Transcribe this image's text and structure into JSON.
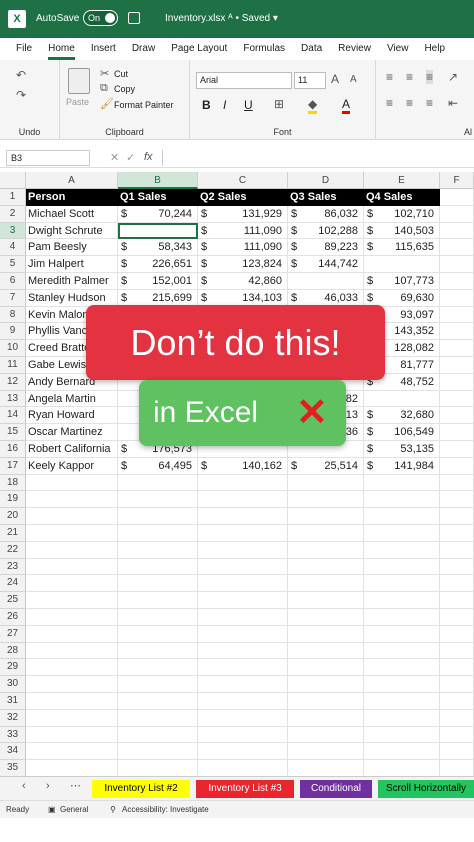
{
  "titlebar": {
    "autosave_label": "AutoSave",
    "toggle_state": "On",
    "filename": "Inventory.xlsx",
    "saved": "• Saved ▾",
    "logo": "X"
  },
  "menu": [
    "File",
    "Home",
    "Insert",
    "Draw",
    "Page Layout",
    "Formulas",
    "Data",
    "Review",
    "View",
    "Help"
  ],
  "menu_active": "Home",
  "ribbon": {
    "undo_group": "Undo",
    "clipboard_group": "Clipboard",
    "paste": "Paste",
    "cut": "Cut",
    "copy": "Copy",
    "format_painter": "Format Painter",
    "font_group": "Font",
    "font_name": "Arial",
    "font_size": "11",
    "bold": "B",
    "italic": "I",
    "underline": "U",
    "alignment_group_partial": "Al"
  },
  "formula_bar": {
    "name_box": "B3",
    "formula": ""
  },
  "columns": [
    "A",
    "B",
    "C",
    "D",
    "E",
    "F"
  ],
  "selected_column": "B",
  "selected_row": 3,
  "headers": [
    "Person",
    "Q1 Sales",
    "Q2 Sales",
    "Q3 Sales",
    "Q4 Sales"
  ],
  "rows": [
    [
      "Michael Scott",
      "70,244",
      "131,929",
      "86,032",
      "102,710"
    ],
    [
      "Dwight Schrute",
      "",
      "111,090",
      "102,288",
      "140,503"
    ],
    [
      "Pam Beesly",
      "58,343",
      "111,090",
      "89,223",
      "115,635"
    ],
    [
      "Jim Halpert",
      "226,651",
      "123,824",
      "144,742",
      ""
    ],
    [
      "Meredith Palmer",
      "152,001",
      "42,860",
      "",
      "107,773"
    ],
    [
      "Stanley Hudson",
      "215,699",
      "134,103",
      "46,033",
      "69,630"
    ],
    [
      "Kevin Malone",
      "",
      "",
      "",
      "93,097"
    ],
    [
      "Phyllis Vance",
      "",
      "",
      "",
      "143,352"
    ],
    [
      "Creed Bratton",
      "",
      "",
      "",
      "128,082"
    ],
    [
      "Gabe Lewis",
      "",
      "",
      "",
      "81,777"
    ],
    [
      "Andy Bernard",
      "",
      "",
      "",
      "48,752"
    ],
    [
      "Angela Martin",
      "",
      "",
      "82",
      ""
    ],
    [
      "Ryan Howard",
      "",
      "",
      "13",
      "32,680"
    ],
    [
      "Oscar Martinez",
      "",
      "",
      "36",
      "106,549"
    ],
    [
      "Robert California",
      "176,573",
      "",
      "",
      "53,135"
    ],
    [
      "Keely Kappor",
      "64,495",
      "140,162",
      "25,514",
      "141,984"
    ]
  ],
  "row_count": 35,
  "sheet_tabs": [
    {
      "label": "Inventory List #2",
      "color": "#ffff00",
      "text": "#000000"
    },
    {
      "label": "Inventory List #3",
      "color": "#e8262f",
      "text": "#ffffff"
    },
    {
      "label": "Conditional",
      "color": "#7030a0",
      "text": "#ffffff"
    },
    {
      "label": "Scroll Horizontally",
      "color": "#22c55e",
      "text": "#000000"
    }
  ],
  "status": {
    "ready": "Ready",
    "general": "General",
    "accessibility": "Accessibility: Investigate"
  },
  "overlay": {
    "line1": "Don’t do this!",
    "line2": "in Excel",
    "mark": "✕"
  },
  "currency": "$",
  "colors": {
    "brand": "#1e7145",
    "overlay_red": "#e33240",
    "overlay_green": "#5fc160"
  }
}
